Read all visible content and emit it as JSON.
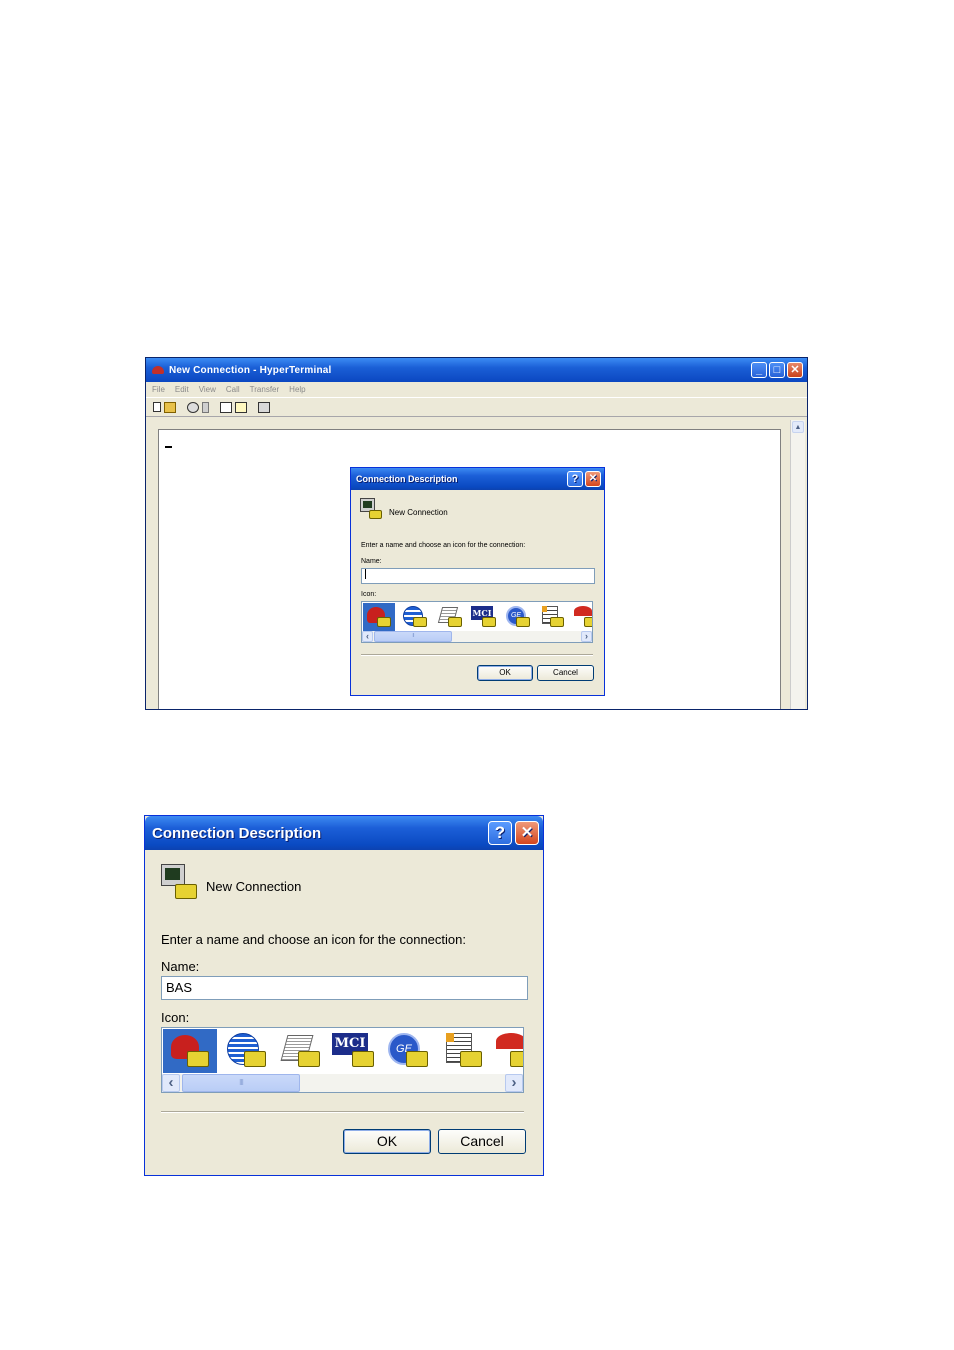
{
  "hyperterminal": {
    "title": "New Connection - HyperTerminal",
    "menu": [
      "File",
      "Edit",
      "View",
      "Call",
      "Transfer",
      "Help"
    ],
    "window_controls": {
      "minimize": "_",
      "maximize": "□",
      "close": "✕"
    }
  },
  "dialog_small": {
    "title": "Connection Description",
    "help_button": "?",
    "close_button": "✕",
    "connection_label": "New Connection",
    "instruction": "Enter a name and choose an icon for the connection:",
    "name_label": "Name:",
    "name_value": "",
    "icon_label": "Icon:",
    "ok_label": "OK",
    "cancel_label": "Cancel"
  },
  "dialog_large": {
    "title": "Connection Description",
    "help_button": "?",
    "close_button": "✕",
    "connection_label": "New Connection",
    "instruction": "Enter a name and choose an icon for the connection:",
    "name_label": "Name:",
    "name_value": "BAS",
    "icon_label": "Icon:",
    "ok_label": "OK",
    "cancel_label": "Cancel"
  },
  "icons": {
    "mci_text": "MCI",
    "ge_text": "GE",
    "list": [
      "red-phone-icon",
      "globe-icon",
      "fax-icon",
      "mci-icon",
      "ge-icon",
      "notes-icon",
      "umbrella-icon"
    ],
    "selected_index": 0
  },
  "scroll": {
    "left_arrow": "‹",
    "right_arrow": "›",
    "thumb_grip": "III",
    "up_arrow": "▲"
  }
}
